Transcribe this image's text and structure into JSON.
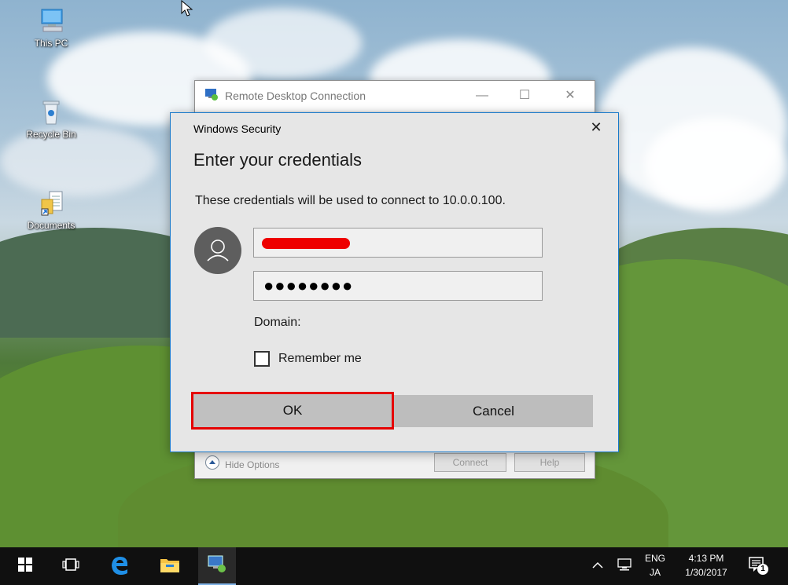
{
  "desktop": {
    "icons": [
      {
        "label": "This PC",
        "icon": "this-pc-icon"
      },
      {
        "label": "Recycle Bin",
        "icon": "recycle-bin-icon"
      },
      {
        "label": "Documents",
        "icon": "documents-icon"
      }
    ]
  },
  "rdc_window": {
    "title": "Remote Desktop Connection",
    "minimize": "—",
    "maximize": "☐",
    "close": "✕",
    "hide_options_label": "Hide Options",
    "connect_label": "Connect",
    "help_label": "Help"
  },
  "security_dialog": {
    "header": "Windows Security",
    "close": "✕",
    "heading": "Enter your credentials",
    "description": "These credentials will be used to connect to 10.0.0.100.",
    "username_value": "",
    "password_value": "●●●●●●●●",
    "domain_label": "Domain:",
    "remember_label": "Remember me",
    "remember_checked": false,
    "ok_label": "OK",
    "cancel_label": "Cancel",
    "accent_color": "#1979ca",
    "highlight_color": "#e50000"
  },
  "taskbar": {
    "pinned": [
      "start-icon",
      "task-view-icon",
      "edge-icon",
      "file-explorer-icon",
      "remote-desktop-icon"
    ],
    "language_top": "ENG",
    "language_bottom": "JA",
    "time": "4:13 PM",
    "date": "1/30/2017",
    "notification_count": "1"
  }
}
